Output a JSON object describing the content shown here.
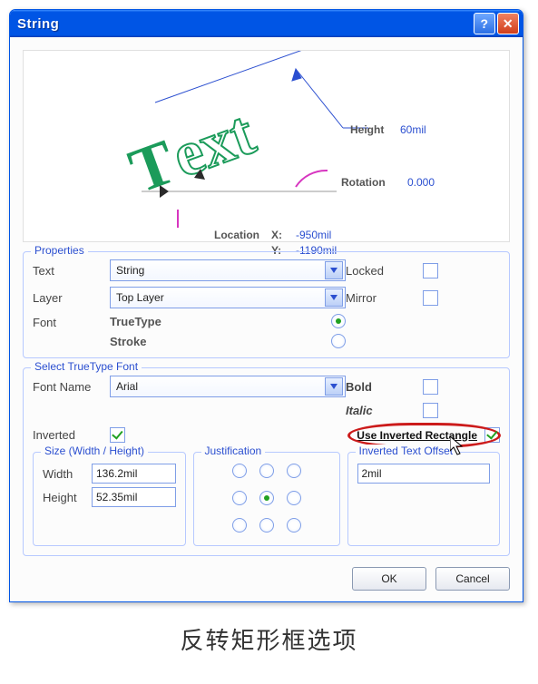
{
  "window": {
    "title": "String"
  },
  "preview": {
    "height_label": "Height",
    "height_value": "60mil",
    "rotation_label": "Rotation",
    "rotation_value": "0.000",
    "location_label": "Location",
    "x_label": "X:",
    "x_value": "-950mil",
    "y_label": "Y:",
    "y_value": "-1190mil",
    "sample_text": "Text"
  },
  "properties": {
    "legend": "Properties",
    "text_label": "Text",
    "text_value": "String",
    "layer_label": "Layer",
    "layer_value": "Top Layer",
    "locked_label": "Locked",
    "locked": false,
    "mirror_label": "Mirror",
    "mirror": false,
    "font_label": "Font",
    "truetype_label": "TrueType",
    "truetype_selected": true,
    "stroke_label": "Stroke",
    "stroke_selected": false
  },
  "stf": {
    "legend": "Select TrueType Font",
    "font_name_label": "Font Name",
    "font_name_value": "Arial",
    "bold_label": "Bold",
    "bold": false,
    "italic_label": "Italic",
    "italic": false,
    "inverted_label": "Inverted",
    "inverted": true,
    "use_inv_rect_label": "Use Inverted Rectangle",
    "use_inv_rect": true,
    "size": {
      "legend": "Size (Width / Height)",
      "width_label": "Width",
      "width_value": "136.2mil",
      "height_label": "Height",
      "height_value": "52.35mil"
    },
    "justification": {
      "legend": "Justification",
      "selected_index": 4
    },
    "offset": {
      "legend": "Inverted Text Offset",
      "value": "2mil"
    }
  },
  "buttons": {
    "ok": "OK",
    "cancel": "Cancel"
  },
  "caption": "反转矩形框选项"
}
